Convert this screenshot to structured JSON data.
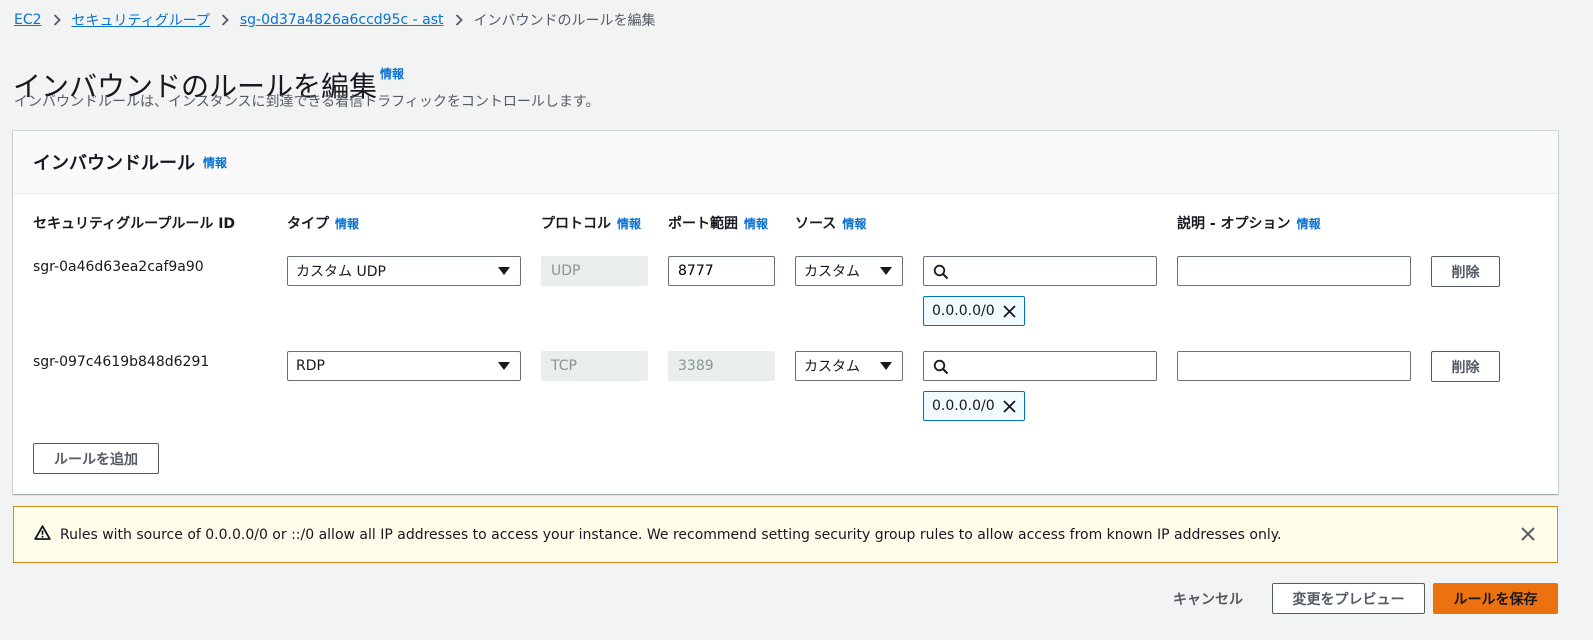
{
  "breadcrumb": {
    "items": [
      {
        "label": "EC2"
      },
      {
        "label": "セキュリティグループ"
      },
      {
        "label": "sg-0d37a4826a6ccd95c - ast"
      }
    ],
    "current": "インバウンドのルールを編集"
  },
  "page": {
    "title": "インバウンドのルールを編集",
    "info_label": "情報",
    "description": "インバウンドルールは、インスタンスに到達できる着信トラフィックをコントロールします。"
  },
  "panel": {
    "title": "インバウンドルール",
    "info_label": "情報",
    "columns": {
      "rule_id": "セキュリティグループルール ID",
      "type": "タイプ",
      "protocol": "プロトコル",
      "port_range": "ポート範囲",
      "source": "ソース",
      "description": "説明 - オプション"
    },
    "rules": [
      {
        "rule_id": "sgr-0a46d63ea2caf9a90",
        "type": "カスタム UDP",
        "protocol": "UDP",
        "port_range": "8777",
        "source": "カスタム",
        "search_value": "",
        "cidr": "0.0.0.0/0",
        "description": "",
        "delete_label": "削除"
      },
      {
        "rule_id": "sgr-097c4619b848d6291",
        "type": "RDP",
        "protocol": "TCP",
        "port_range": "3389",
        "source": "カスタム",
        "search_value": "",
        "cidr": "0.0.0.0/0",
        "description": "",
        "delete_label": "削除"
      }
    ],
    "add_rule_label": "ルールを追加"
  },
  "alert": {
    "text": "Rules with source of 0.0.0.0/0 or ::/0 allow all IP addresses to access your instance. We recommend setting security group rules to allow access from known IP addresses only."
  },
  "footer": {
    "cancel_label": "キャンセル",
    "preview_label": "変更をプレビュー",
    "save_label": "ルールを保存"
  },
  "colors": {
    "link": "#0972d3",
    "primary_button": "#ec7211",
    "warning_border": "#d48a1a",
    "warning_background": "#fffce9"
  }
}
